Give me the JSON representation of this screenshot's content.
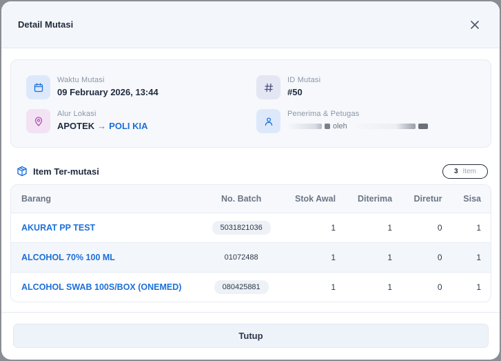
{
  "modal": {
    "title": "Detail Mutasi",
    "close_icon": "close-icon"
  },
  "info": {
    "waktu": {
      "label": "Waktu Mutasi",
      "value": "09 February 2026, 13:44",
      "icon": "calendar-icon"
    },
    "id": {
      "label": "ID Mutasi",
      "value": "#50",
      "icon": "hash-icon"
    },
    "alur": {
      "label": "Alur Lokasi",
      "from": "APOTEK",
      "arrow": "→",
      "to": "POLI KIA",
      "icon": "map-pin-icon"
    },
    "penerima": {
      "label": "Penerima & Petugas",
      "connector": "oleh",
      "icon": "user-icon"
    }
  },
  "items_section": {
    "title": "Item Ter-mutasi",
    "count": "3",
    "count_unit": "Item",
    "icon": "package-icon"
  },
  "table": {
    "headers": [
      "Barang",
      "No. Batch",
      "Stok Awal",
      "Diterima",
      "Diretur",
      "Sisa"
    ],
    "rows": [
      {
        "barang": "AKURAT PP TEST",
        "batch": "5031821036",
        "stok_awal": "1",
        "diterima": "1",
        "diretur": "0",
        "sisa": "1"
      },
      {
        "barang": "ALCOHOL 70% 100 ML",
        "batch": "01072488",
        "stok_awal": "1",
        "diterima": "1",
        "diretur": "0",
        "sisa": "1"
      },
      {
        "barang": "ALCOHOL SWAB 100S/BOX (ONEMED)",
        "batch": "080425881",
        "stok_awal": "1",
        "diterima": "1",
        "diretur": "0",
        "sisa": "1"
      }
    ]
  },
  "footer": {
    "close_label": "Tutup"
  },
  "colors": {
    "accent": "#1d6fd8",
    "calendar_bg": "#dde9fb",
    "hash_bg": "#e4e6f3",
    "pin_bg": "#f3e2f3",
    "user_bg": "#dde9fb"
  }
}
